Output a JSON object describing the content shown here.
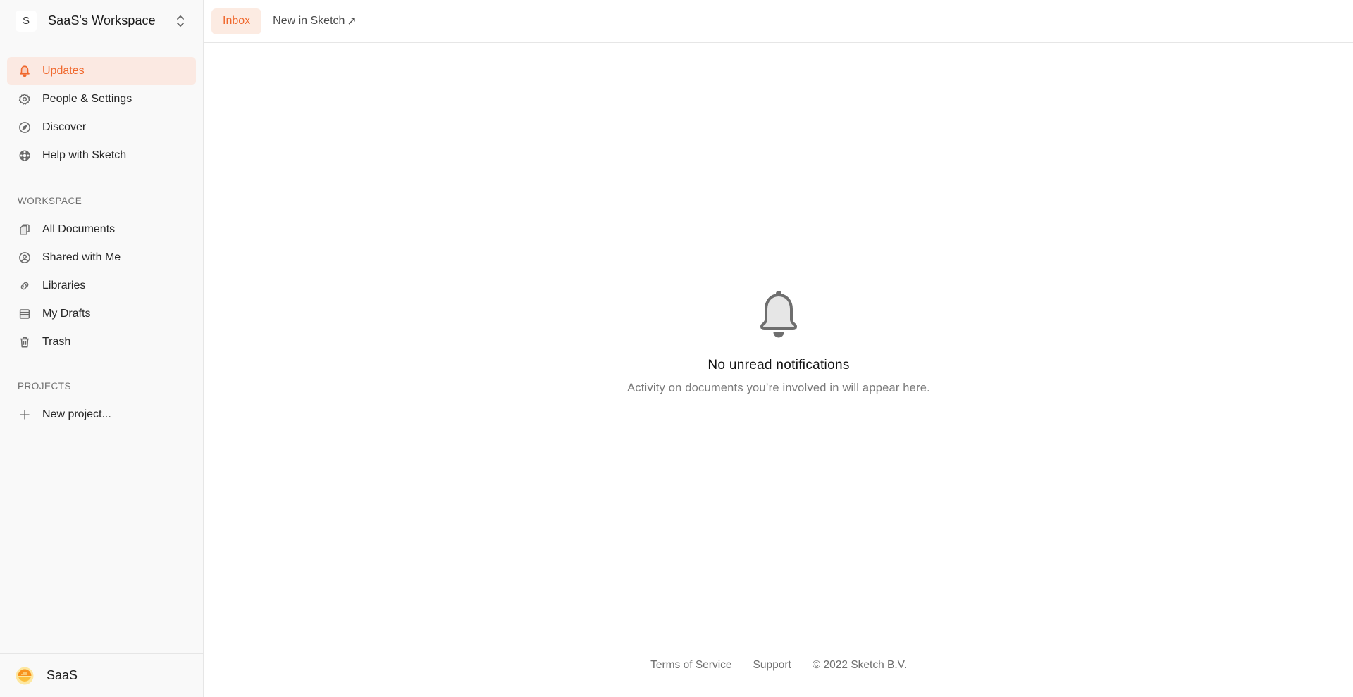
{
  "workspace": {
    "initial": "S",
    "name": "SaaS's Workspace",
    "switcher_icon": "chevron-up-down-icon"
  },
  "sidebar": {
    "primary": [
      {
        "label": "Updates",
        "icon": "bell-icon",
        "active": true
      },
      {
        "label": "People & Settings",
        "icon": "gear-icon",
        "active": false
      },
      {
        "label": "Discover",
        "icon": "compass-icon",
        "active": false
      },
      {
        "label": "Help with Sketch",
        "icon": "lifebuoy-icon",
        "active": false
      }
    ],
    "workspace_section": {
      "label": "WORKSPACE",
      "items": [
        {
          "label": "All Documents",
          "icon": "documents-icon"
        },
        {
          "label": "Shared with Me",
          "icon": "user-circle-icon"
        },
        {
          "label": "Libraries",
          "icon": "link-icon"
        },
        {
          "label": "My Drafts",
          "icon": "drafts-icon"
        },
        {
          "label": "Trash",
          "icon": "trash-icon"
        }
      ]
    },
    "projects_section": {
      "label": "PROJECTS",
      "new_project": {
        "label": "New project...",
        "icon": "plus-icon"
      }
    }
  },
  "user": {
    "name": "SaaS",
    "avatar": "sunset-avatar"
  },
  "tabs": [
    {
      "label": "Inbox",
      "active": true
    },
    {
      "label": "New in Sketch",
      "external": "↗",
      "active": false
    }
  ],
  "empty_state": {
    "icon": "bell-icon",
    "title": "No unread notifications",
    "subtitle": "Activity on documents you’re involved in will appear here."
  },
  "footer": {
    "terms": "Terms of Service",
    "support": "Support",
    "copyright": "© 2022 Sketch B.V."
  },
  "colors": {
    "accent": "#f0682d",
    "accent_bg": "#fbe9e2",
    "sidebar_bg": "#f9f9f9",
    "border": "#e6e6e6"
  }
}
